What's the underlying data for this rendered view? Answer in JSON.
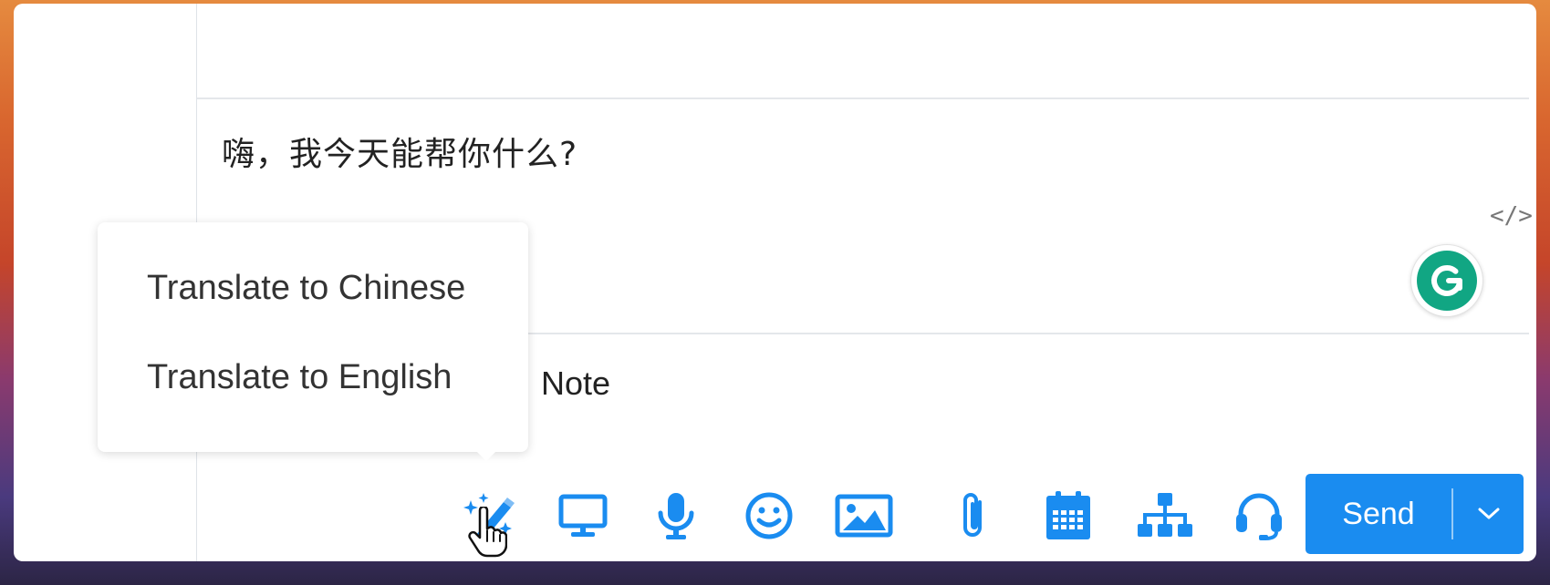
{
  "composer": {
    "message_text": "嗨，我今天能帮你什么?",
    "code_toggle_label": "</>",
    "note_label": "Note"
  },
  "translate_menu": {
    "items": [
      {
        "label": "Translate to Chinese"
      },
      {
        "label": "Translate to English"
      }
    ]
  },
  "toolbar": {
    "icons": [
      "ai-magic-wand-icon",
      "screen-share-icon",
      "microphone-icon",
      "emoji-icon",
      "image-icon",
      "attachment-icon",
      "calendar-icon",
      "org-chart-icon",
      "headset-icon"
    ],
    "send_label": "Send"
  },
  "colors": {
    "accent": "#1a8cf0",
    "grammarly": "#11a683"
  }
}
